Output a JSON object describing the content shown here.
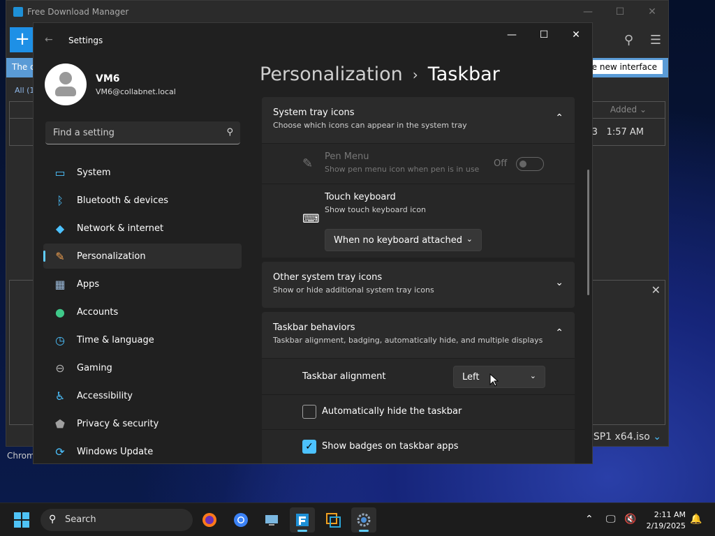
{
  "fdm": {
    "title": "Free Download Manager",
    "add_label": "+",
    "banner_text": "The c",
    "banner_button": "he new interface",
    "filter_all": "All (1)",
    "col_added": "Added ⌄",
    "row_time": "1:57 AM",
    "row_extra": "3",
    "iso_name": "SP1 x64.iso",
    "chrom_label": "Chrom"
  },
  "settings": {
    "window_title": "Settings",
    "user": {
      "name": "VM6",
      "email": "VM6@collabnet.local"
    },
    "search_placeholder": "Find a setting",
    "nav": [
      {
        "label": "System",
        "icon": "monitor-icon",
        "color": "#4cc2ff"
      },
      {
        "label": "Bluetooth & devices",
        "icon": "bluetooth-icon",
        "color": "#4cc2ff"
      },
      {
        "label": "Network & internet",
        "icon": "wifi-icon",
        "color": "#4cc2ff"
      },
      {
        "label": "Personalization",
        "icon": "brush-icon",
        "color": "#f0a050"
      },
      {
        "label": "Apps",
        "icon": "apps-icon",
        "color": "#9ab8d8"
      },
      {
        "label": "Accounts",
        "icon": "person-icon",
        "color": "#3fc98a"
      },
      {
        "label": "Time & language",
        "icon": "globe-clock-icon",
        "color": "#4cc2ff"
      },
      {
        "label": "Gaming",
        "icon": "gamepad-icon",
        "color": "#b0b0b0"
      },
      {
        "label": "Accessibility",
        "icon": "accessibility-icon",
        "color": "#4cc2ff"
      },
      {
        "label": "Privacy & security",
        "icon": "shield-icon",
        "color": "#a0a0a0"
      },
      {
        "label": "Windows Update",
        "icon": "update-icon",
        "color": "#4cc2ff"
      }
    ],
    "active_nav": "Personalization",
    "breadcrumb": {
      "parent": "Personalization",
      "separator": "›",
      "current": "Taskbar"
    },
    "system_tray": {
      "title": "System tray icons",
      "subtitle": "Choose which icons can appear in the system tray",
      "pen_menu": {
        "title": "Pen Menu",
        "subtitle": "Show pen menu icon when pen is in use",
        "state": "Off"
      },
      "touch_keyboard": {
        "title": "Touch keyboard",
        "subtitle": "Show touch keyboard icon",
        "value": "When no keyboard attached"
      }
    },
    "other_tray": {
      "title": "Other system tray icons",
      "subtitle": "Show or hide additional system tray icons"
    },
    "behaviors": {
      "title": "Taskbar behaviors",
      "subtitle": "Taskbar alignment, badging, automatically hide, and multiple displays",
      "alignment_label": "Taskbar alignment",
      "alignment_value": "Left",
      "autohide_label": "Automatically hide the taskbar",
      "autohide_checked": false,
      "badges_label": "Show badges on taskbar apps",
      "badges_checked": true
    }
  },
  "taskbar": {
    "search_label": "Search",
    "time": "2:11 AM",
    "date": "2/19/2025",
    "apps": [
      "firefox-icon",
      "chrome-icon",
      "network-app-icon",
      "fdm-icon",
      "virtualbox-icon",
      "settings-gear-icon"
    ]
  }
}
